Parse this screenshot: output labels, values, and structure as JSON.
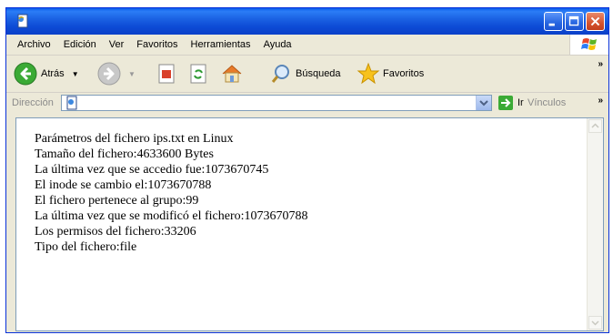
{
  "menubar": {
    "items": [
      "Archivo",
      "Edición",
      "Ver",
      "Favoritos",
      "Herramientas",
      "Ayuda"
    ]
  },
  "toolbar": {
    "back_label": "Atrás",
    "search_label": "Búsqueda",
    "favorites_label": "Favoritos"
  },
  "addressbar": {
    "label": "Dirección",
    "go_label": "Ir",
    "links_label": "Vínculos"
  },
  "content": {
    "lines": [
      "Parámetros del fichero ips.txt en Linux",
      "Tamaño del fichero:4633600 Bytes",
      "La última vez que se accedio fue:1073670745",
      "El inode se cambio el:1073670788",
      "El fichero pertenece al grupo:99",
      "La última vez que se modificó el fichero:1073670788",
      "Los permisos del fichero:33206",
      "Tipo del fichero:file"
    ]
  },
  "colors": {
    "titlebar": "#0A5BEB",
    "close_button": "#D5532E",
    "chrome": "#ECE9D8"
  }
}
